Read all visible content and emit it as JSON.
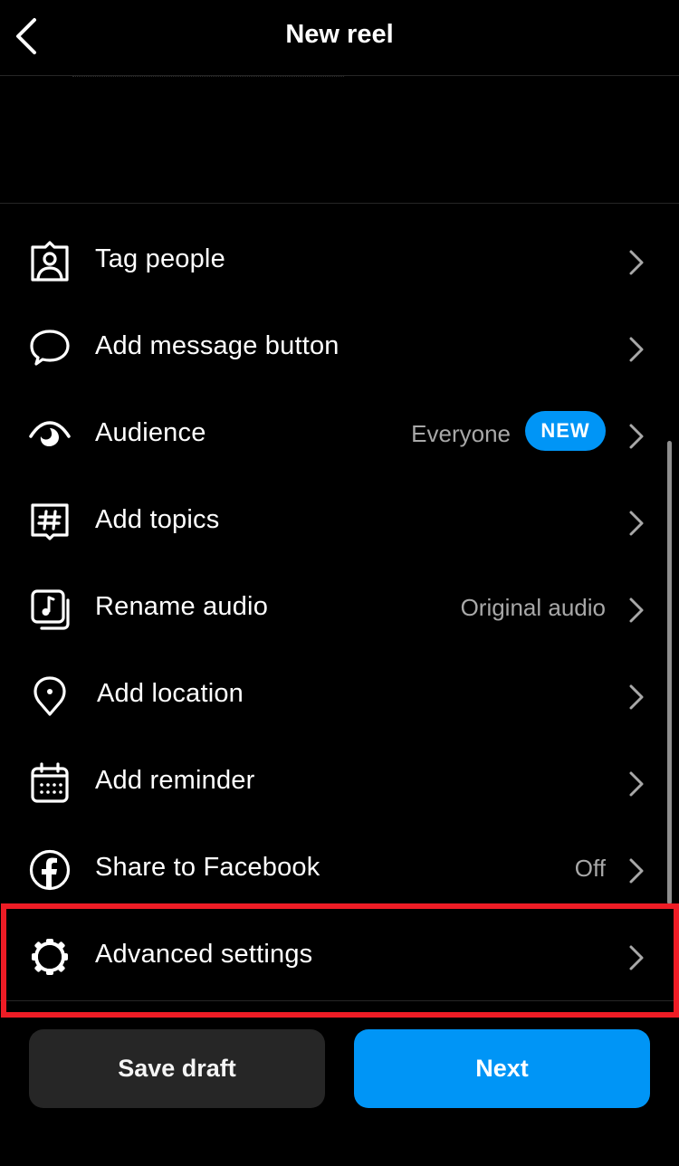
{
  "header": {
    "title": "New reel",
    "back_icon": "chevron-left-icon"
  },
  "colors": {
    "background": "#000000",
    "accent": "#0095f6",
    "secondary_button": "#262626",
    "secondary_text": "#a8a8a8",
    "highlight": "#ee1c25"
  },
  "settings": {
    "items": [
      {
        "label": "Tag people",
        "icon": "tag-people-icon",
        "value": null
      },
      {
        "label": "Add message button",
        "icon": "chat-bubble-icon",
        "value": null
      },
      {
        "label": "Audience",
        "icon": "audience-eye-icon",
        "value": "Everyone",
        "badge": "NEW"
      },
      {
        "label": "Add topics",
        "icon": "hashtag-icon",
        "value": null
      },
      {
        "label": "Rename audio",
        "icon": "music-note-icon",
        "value": "Original audio"
      },
      {
        "label": "Add location",
        "icon": "location-pin-icon",
        "value": null
      },
      {
        "label": "Add reminder",
        "icon": "calendar-icon",
        "value": null
      },
      {
        "label": "Share to Facebook",
        "icon": "facebook-icon",
        "value": "Off"
      },
      {
        "label": "Advanced settings",
        "icon": "gear-icon",
        "value": null,
        "highlighted": true
      }
    ]
  },
  "footer": {
    "save_draft_label": "Save draft",
    "next_label": "Next"
  }
}
